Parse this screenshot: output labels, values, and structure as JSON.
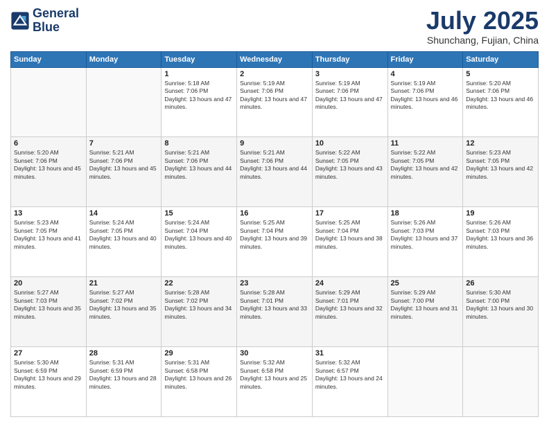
{
  "header": {
    "logo_line1": "General",
    "logo_line2": "Blue",
    "month": "July 2025",
    "location": "Shunchang, Fujian, China"
  },
  "weekdays": [
    "Sunday",
    "Monday",
    "Tuesday",
    "Wednesday",
    "Thursday",
    "Friday",
    "Saturday"
  ],
  "weeks": [
    [
      {
        "day": "",
        "info": ""
      },
      {
        "day": "",
        "info": ""
      },
      {
        "day": "1",
        "info": "Sunrise: 5:18 AM\nSunset: 7:06 PM\nDaylight: 13 hours and 47 minutes."
      },
      {
        "day": "2",
        "info": "Sunrise: 5:19 AM\nSunset: 7:06 PM\nDaylight: 13 hours and 47 minutes."
      },
      {
        "day": "3",
        "info": "Sunrise: 5:19 AM\nSunset: 7:06 PM\nDaylight: 13 hours and 47 minutes."
      },
      {
        "day": "4",
        "info": "Sunrise: 5:19 AM\nSunset: 7:06 PM\nDaylight: 13 hours and 46 minutes."
      },
      {
        "day": "5",
        "info": "Sunrise: 5:20 AM\nSunset: 7:06 PM\nDaylight: 13 hours and 46 minutes."
      }
    ],
    [
      {
        "day": "6",
        "info": "Sunrise: 5:20 AM\nSunset: 7:06 PM\nDaylight: 13 hours and 45 minutes."
      },
      {
        "day": "7",
        "info": "Sunrise: 5:21 AM\nSunset: 7:06 PM\nDaylight: 13 hours and 45 minutes."
      },
      {
        "day": "8",
        "info": "Sunrise: 5:21 AM\nSunset: 7:06 PM\nDaylight: 13 hours and 44 minutes."
      },
      {
        "day": "9",
        "info": "Sunrise: 5:21 AM\nSunset: 7:06 PM\nDaylight: 13 hours and 44 minutes."
      },
      {
        "day": "10",
        "info": "Sunrise: 5:22 AM\nSunset: 7:05 PM\nDaylight: 13 hours and 43 minutes."
      },
      {
        "day": "11",
        "info": "Sunrise: 5:22 AM\nSunset: 7:05 PM\nDaylight: 13 hours and 42 minutes."
      },
      {
        "day": "12",
        "info": "Sunrise: 5:23 AM\nSunset: 7:05 PM\nDaylight: 13 hours and 42 minutes."
      }
    ],
    [
      {
        "day": "13",
        "info": "Sunrise: 5:23 AM\nSunset: 7:05 PM\nDaylight: 13 hours and 41 minutes."
      },
      {
        "day": "14",
        "info": "Sunrise: 5:24 AM\nSunset: 7:05 PM\nDaylight: 13 hours and 40 minutes."
      },
      {
        "day": "15",
        "info": "Sunrise: 5:24 AM\nSunset: 7:04 PM\nDaylight: 13 hours and 40 minutes."
      },
      {
        "day": "16",
        "info": "Sunrise: 5:25 AM\nSunset: 7:04 PM\nDaylight: 13 hours and 39 minutes."
      },
      {
        "day": "17",
        "info": "Sunrise: 5:25 AM\nSunset: 7:04 PM\nDaylight: 13 hours and 38 minutes."
      },
      {
        "day": "18",
        "info": "Sunrise: 5:26 AM\nSunset: 7:03 PM\nDaylight: 13 hours and 37 minutes."
      },
      {
        "day": "19",
        "info": "Sunrise: 5:26 AM\nSunset: 7:03 PM\nDaylight: 13 hours and 36 minutes."
      }
    ],
    [
      {
        "day": "20",
        "info": "Sunrise: 5:27 AM\nSunset: 7:03 PM\nDaylight: 13 hours and 35 minutes."
      },
      {
        "day": "21",
        "info": "Sunrise: 5:27 AM\nSunset: 7:02 PM\nDaylight: 13 hours and 35 minutes."
      },
      {
        "day": "22",
        "info": "Sunrise: 5:28 AM\nSunset: 7:02 PM\nDaylight: 13 hours and 34 minutes."
      },
      {
        "day": "23",
        "info": "Sunrise: 5:28 AM\nSunset: 7:01 PM\nDaylight: 13 hours and 33 minutes."
      },
      {
        "day": "24",
        "info": "Sunrise: 5:29 AM\nSunset: 7:01 PM\nDaylight: 13 hours and 32 minutes."
      },
      {
        "day": "25",
        "info": "Sunrise: 5:29 AM\nSunset: 7:00 PM\nDaylight: 13 hours and 31 minutes."
      },
      {
        "day": "26",
        "info": "Sunrise: 5:30 AM\nSunset: 7:00 PM\nDaylight: 13 hours and 30 minutes."
      }
    ],
    [
      {
        "day": "27",
        "info": "Sunrise: 5:30 AM\nSunset: 6:59 PM\nDaylight: 13 hours and 29 minutes."
      },
      {
        "day": "28",
        "info": "Sunrise: 5:31 AM\nSunset: 6:59 PM\nDaylight: 13 hours and 28 minutes."
      },
      {
        "day": "29",
        "info": "Sunrise: 5:31 AM\nSunset: 6:58 PM\nDaylight: 13 hours and 26 minutes."
      },
      {
        "day": "30",
        "info": "Sunrise: 5:32 AM\nSunset: 6:58 PM\nDaylight: 13 hours and 25 minutes."
      },
      {
        "day": "31",
        "info": "Sunrise: 5:32 AM\nSunset: 6:57 PM\nDaylight: 13 hours and 24 minutes."
      },
      {
        "day": "",
        "info": ""
      },
      {
        "day": "",
        "info": ""
      }
    ]
  ]
}
